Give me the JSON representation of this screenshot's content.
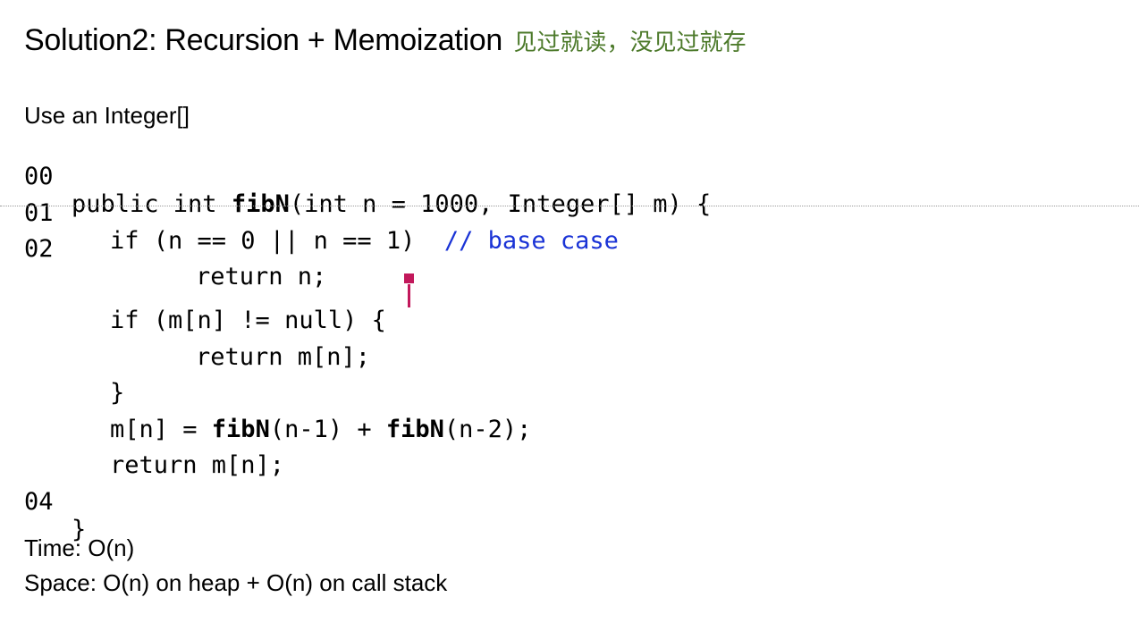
{
  "title": {
    "main": "Solution2: Recursion + Memoization",
    "note": "见过就读，没见过就存"
  },
  "intro": "Use an Integer[]",
  "code": {
    "line00": {
      "num": "00",
      "a": "public int ",
      "b": "fibN",
      "c": "(int n = 1000, Integer[] m) {"
    },
    "line01": {
      "num": "01",
      "a": "if (n == 0 || n == 1)  ",
      "comment": "// base case"
    },
    "line02": {
      "num": "02",
      "a": "return n;"
    },
    "line03": {
      "a": "if (m[n] != null) {"
    },
    "line04": {
      "a": "return m[n];"
    },
    "line05": {
      "a": "}"
    },
    "line06": {
      "a": "m[n] = ",
      "b": "fibN",
      "c": "(n-1) + ",
      "d": "fibN",
      "e": "(n-2);"
    },
    "line07": {
      "a": "return m[n];"
    },
    "line08": {
      "num": "04",
      "a": "}"
    }
  },
  "complexity": {
    "time": "Time: O(n)",
    "space": "Space: O(n) on heap + O(n) on call stack"
  },
  "colors": {
    "note": "#4d7a2b",
    "comment": "#1a33d6",
    "cursor": "#c2185b"
  }
}
